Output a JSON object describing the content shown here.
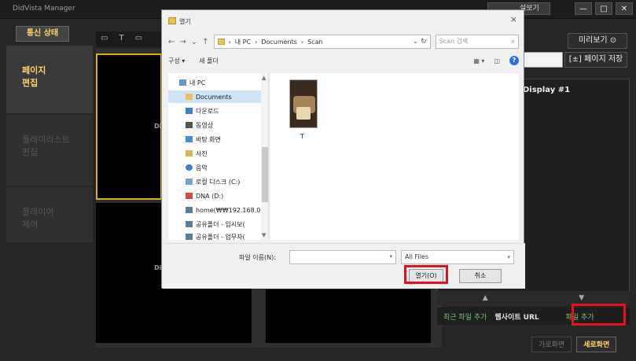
{
  "app": {
    "title": "DidVista Manager",
    "preview_chip": "설보기",
    "window_controls": [
      "—",
      "□",
      "✕"
    ]
  },
  "comm_status": "통신 상태",
  "left_nav": {
    "items": [
      {
        "label": "페이지\n편집",
        "active": true
      },
      {
        "label": "플레이리스트\n편집",
        "active": false
      },
      {
        "label": "플레이어\n제어",
        "active": false
      }
    ]
  },
  "toolbar": {
    "items": [
      "▭",
      "T",
      "▭"
    ]
  },
  "canvas": {
    "tags": [
      "Di",
      "Di"
    ]
  },
  "right_panel": {
    "preview_button": "미리보기 ⊙",
    "page_save_button": "[±] 페이지 저장",
    "display_title": "Display #1",
    "arrows": [
      "▲",
      "▼"
    ],
    "actions": {
      "recent_file": "최근 파일 추가",
      "website_url": "웹사이트 URL",
      "add_file": "파일 추가"
    },
    "bottom": {
      "landscape": "가로화면",
      "portrait": "세로화면"
    }
  },
  "dialog": {
    "title": "열기",
    "breadcrumb": [
      "내 PC",
      "Documents",
      "Scan"
    ],
    "search_placeholder": "Scan 검색",
    "toolbar": {
      "organize": "구성 ▾",
      "new_folder": "새 폴더"
    },
    "tree": [
      {
        "label": "내 PC",
        "icon": "pc-icon"
      },
      {
        "label": "Documents",
        "icon": "folder-icon",
        "selected": true
      },
      {
        "label": "다운로드",
        "icon": "download-icon"
      },
      {
        "label": "동영상",
        "icon": "video-icon"
      },
      {
        "label": "바탕 화면",
        "icon": "desktop-icon"
      },
      {
        "label": "사진",
        "icon": "picture-icon"
      },
      {
        "label": "음악",
        "icon": "music-icon"
      },
      {
        "label": "로컬 디스크 (C:)",
        "icon": "drive-icon"
      },
      {
        "label": "DNA (D:)",
        "icon": "drive-icon"
      },
      {
        "label": "home(₩₩192.168.0",
        "icon": "network-icon"
      },
      {
        "label": "공유폴더 - 임시보(",
        "icon": "network-icon"
      },
      {
        "label": "공유폴더 - 업무자(",
        "icon": "network-icon"
      }
    ],
    "file": {
      "name": "T"
    },
    "filename_label": "파일 이름(N):",
    "filename_value": "",
    "file_filter": "All Files",
    "open_button": "열기(O)",
    "cancel_button": "취소"
  },
  "colors": {
    "accent_yellow": "#ffd36b",
    "highlight_red": "#e3121b",
    "link_green": "#6ec76e"
  }
}
